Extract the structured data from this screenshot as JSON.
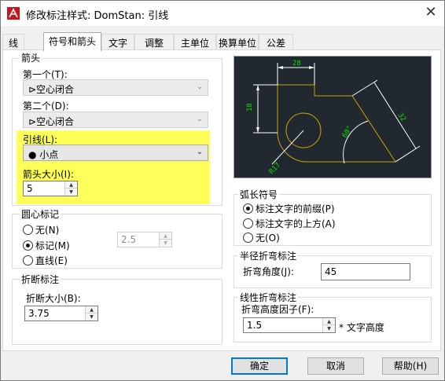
{
  "window": {
    "title": "修改标注样式: DomStan: 引线"
  },
  "tabs": [
    {
      "label": "线"
    },
    {
      "label": "符号和箭头",
      "active": true
    },
    {
      "label": "文字"
    },
    {
      "label": "调整"
    },
    {
      "label": "主单位"
    },
    {
      "label": "换算单位"
    },
    {
      "label": "公差"
    }
  ],
  "arrowheads": {
    "group_label": "箭头",
    "first_label": "第一个(T):",
    "first_value": "⊳空心闭合",
    "second_label": "第二个(D):",
    "second_value": "⊳空心闭合",
    "leader_label": "引线(L):",
    "leader_value": "● 小点",
    "size_label": "箭头大小(I):",
    "size_value": "5"
  },
  "center_marks": {
    "group_label": "圆心标记",
    "options": [
      {
        "label": "无(N)",
        "selected": false
      },
      {
        "label": "标记(M)",
        "selected": true
      },
      {
        "label": "直线(E)",
        "selected": false
      }
    ],
    "size_value": "2.5"
  },
  "dimension_break": {
    "group_label": "折断标注",
    "size_label": "折断大小(B):",
    "size_value": "3.75"
  },
  "arc_length_symbol": {
    "group_label": "弧长符号",
    "options": [
      {
        "label": "标注文字的前缀(P)",
        "selected": true
      },
      {
        "label": "标注文字的上方(A)",
        "selected": false
      },
      {
        "label": "无(O)",
        "selected": false
      }
    ]
  },
  "radius_jog": {
    "group_label": "半径折弯标注",
    "angle_label": "折弯角度(J):",
    "angle_value": "45"
  },
  "linear_jog": {
    "group_label": "线性折弯标注",
    "factor_label": "折弯高度因子(F):",
    "factor_value": "1.5",
    "suffix": "* 文字高度"
  },
  "preview": {
    "dim_top": "28",
    "dim_left": "18",
    "dim_right": "32",
    "dim_angle": "60°",
    "dim_radius": "R17"
  },
  "buttons": {
    "ok": "确定",
    "cancel": "取消",
    "help": "帮助(H)"
  },
  "colors": {
    "highlight": "#ffff5a",
    "preview_bg": "#212830",
    "preview_geometry": "#c8a400",
    "preview_dims": "#ffffff",
    "preview_text": "#00e000",
    "accent": "#0078d7"
  }
}
